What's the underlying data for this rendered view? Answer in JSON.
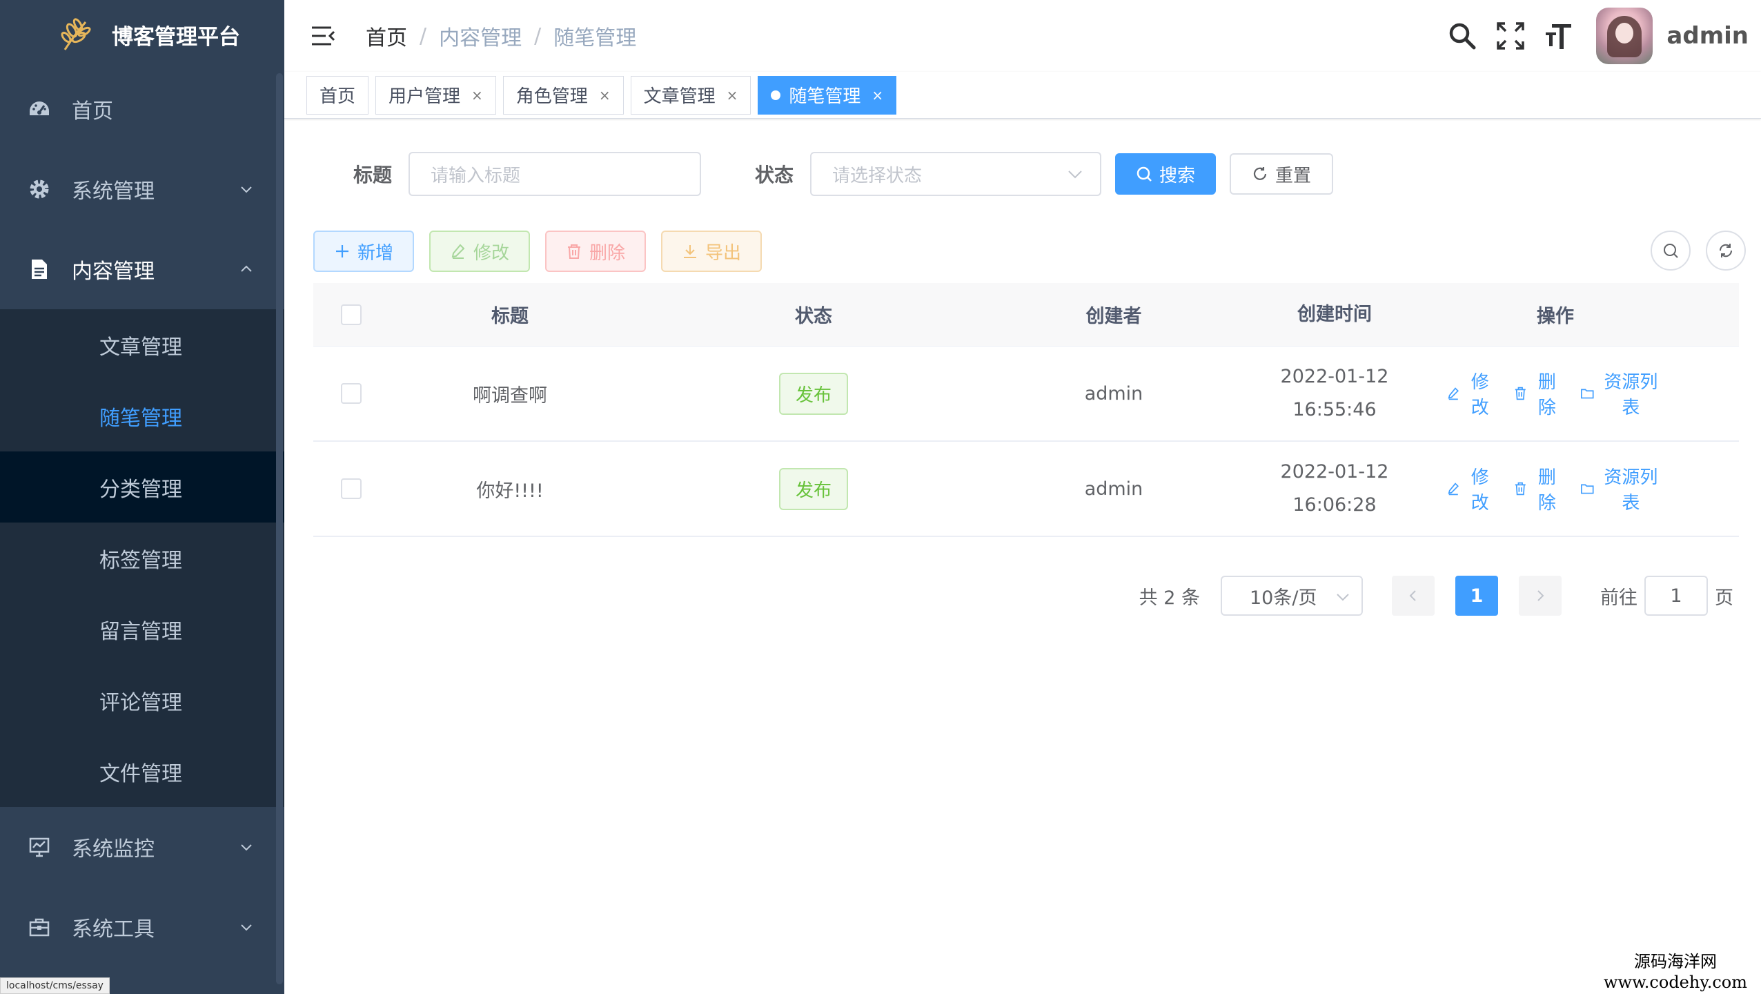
{
  "sidebar": {
    "logo_text": "博客管理平台",
    "menu": [
      {
        "label": "首页"
      },
      {
        "label": "系统管理"
      },
      {
        "label": "内容管理"
      }
    ],
    "submenu": [
      {
        "label": "文章管理"
      },
      {
        "label": "随笔管理"
      },
      {
        "label": "分类管理"
      },
      {
        "label": "标签管理"
      },
      {
        "label": "留言管理"
      },
      {
        "label": "评论管理"
      },
      {
        "label": "文件管理"
      }
    ],
    "menu_after": [
      {
        "label": "系统监控"
      },
      {
        "label": "系统工具"
      }
    ],
    "status_url": "localhost/cms/essay"
  },
  "navbar": {
    "breadcrumb": [
      "首页",
      "内容管理",
      "随笔管理"
    ],
    "username": "admin"
  },
  "tags": [
    {
      "label": "首页"
    },
    {
      "label": "用户管理"
    },
    {
      "label": "角色管理"
    },
    {
      "label": "文章管理"
    },
    {
      "label": "随笔管理"
    }
  ],
  "search": {
    "title_label": "标题",
    "title_placeholder": "请输入标题",
    "status_label": "状态",
    "status_placeholder": "请选择状态",
    "search_btn": "搜索",
    "reset_btn": "重置"
  },
  "toolbar": {
    "add": "新增",
    "edit": "修改",
    "delete": "删除",
    "export": "导出"
  },
  "table": {
    "headers": {
      "title": "标题",
      "status": "状态",
      "creator": "创建者",
      "created": "创建时间",
      "ops": "操作"
    },
    "rows": [
      {
        "title": "啊调查啊",
        "status": "发布",
        "creator": "admin",
        "date": "2022-01-12",
        "time": "16:55:46"
      },
      {
        "title": "你好!!!!",
        "status": "发布",
        "creator": "admin",
        "date": "2022-01-12",
        "time": "16:06:28"
      }
    ],
    "op_labels": {
      "edit": "修改",
      "delete": "删除",
      "resources": "资源列表"
    }
  },
  "pagination": {
    "total": "共 2 条",
    "page_size": "10条/页",
    "current": "1",
    "goto_label": "前往",
    "goto_value": "1",
    "page_suffix": "页"
  },
  "watermark": {
    "line1": "源码海洋网",
    "line2": "www.codehy.com"
  },
  "colors": {
    "sidebar_bg": "#304156",
    "submenu_bg": "#1f2d3d",
    "primary": "#409eff",
    "success": "#67c23a"
  }
}
